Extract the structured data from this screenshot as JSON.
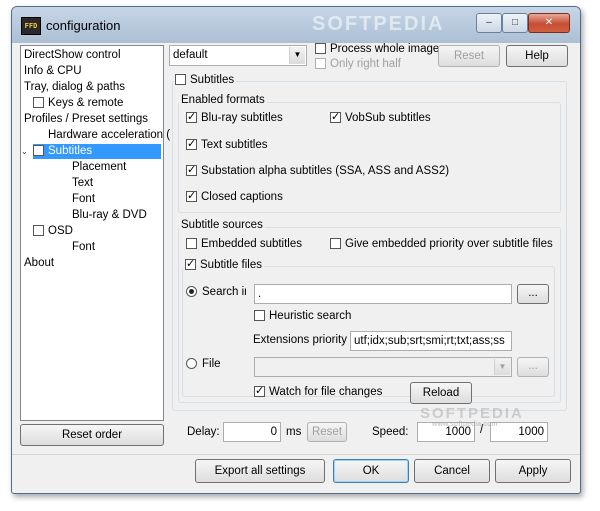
{
  "window": {
    "title": "configuration",
    "app_icon_text": "FFD",
    "minimize": "–",
    "maximize": "□",
    "close": "✕"
  },
  "tree": {
    "items": [
      {
        "label": "DirectShow control"
      },
      {
        "label": "Info & CPU"
      },
      {
        "label": "Tray, dialog & paths"
      },
      {
        "label": "Keys & remote"
      },
      {
        "label": "Profiles / Preset settings"
      },
      {
        "label": "Hardware acceleration ("
      },
      {
        "label": "Subtitles"
      },
      {
        "label": "Placement"
      },
      {
        "label": "Text"
      },
      {
        "label": "Font"
      },
      {
        "label": "Blu-ray & DVD"
      },
      {
        "label": "OSD"
      },
      {
        "label": "Font"
      },
      {
        "label": "About"
      }
    ],
    "chevron": "⌄",
    "reset_order": "Reset order"
  },
  "toolbar": {
    "preset_value": "default",
    "process_whole_image": "Process whole image",
    "only_right_half": "Only right half",
    "reset": "Reset",
    "help": "Help"
  },
  "subtitles": {
    "enable_label": "Subtitles",
    "enabled_formats_title": "Enabled formats",
    "formats": {
      "bluray": "Blu-ray subtitles",
      "vobsub": "VobSub subtitles",
      "text": "Text subtitles",
      "ssa": "Substation alpha subtitles (SSA, ASS and ASS2)",
      "cc": "Closed captions"
    },
    "sources_title": "Subtitle sources",
    "embedded": "Embedded subtitles",
    "embedded_priority": "Give embedded priority over subtitle files",
    "subtitle_files": "Subtitle files",
    "search_in": "Search in",
    "search_path": ".",
    "browse": "...",
    "heuristic": "Heuristic search",
    "ext_priority_label": "Extensions priority",
    "ext_priority_value": "utf;idx;sub;srt;smi;rt;txt;ass;ss",
    "file": "File",
    "file_value": "",
    "watch": "Watch for file changes",
    "reload": "Reload"
  },
  "timing": {
    "delay_label": "Delay:",
    "delay_value": "0",
    "delay_unit": "ms",
    "reset": "Reset",
    "speed_label": "Speed:",
    "speed_num": "1000",
    "speed_sep": "/",
    "speed_den": "1000"
  },
  "footer": {
    "export": "Export all settings",
    "ok": "OK",
    "cancel": "Cancel",
    "apply": "Apply"
  },
  "watermark": {
    "top": "SOFTPEDIA",
    "bottom": "SOFTPEDIA",
    "bottom_sub": "www.softpedia.com"
  }
}
